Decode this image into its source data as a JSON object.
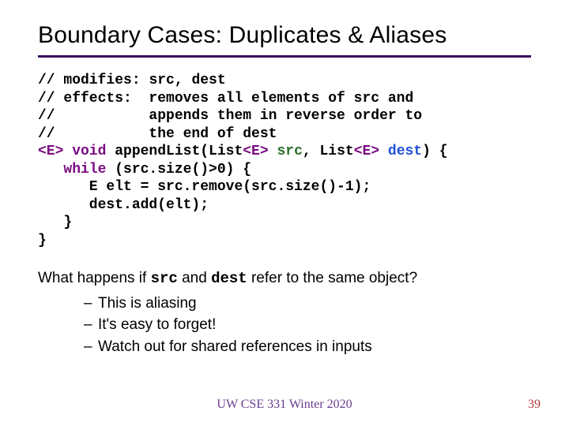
{
  "title": "Boundary Cases: Duplicates & Aliases",
  "code": {
    "c1a": "// modifies: ",
    "c1b": "src",
    "c1c": ", ",
    "c1d": "dest",
    "c2": "// effects:  removes all elements of src and",
    "c3": "//           appends them in reverse order to",
    "c4": "//           the end of dest",
    "l5_kw1": "<E> void",
    "l5_fn": " appendList(List",
    "l5_kw2": "<E>",
    "l5_sp1": " ",
    "l5_src": "src",
    "l5_mid": ", List",
    "l5_kw3": "<E>",
    "l5_sp2": " ",
    "l5_dst": "dest",
    "l5_end": ") {",
    "l6_ind": "   ",
    "l6_kw": "while",
    "l6_rest": " (src.size()>0) {",
    "l7": "      E elt = src.remove(src.size()-1);",
    "l8": "      dest.add(elt);",
    "l9": "   }",
    "l10": "}"
  },
  "question": {
    "q1": "What happens if ",
    "src": "src",
    "q2": " and ",
    "dst": "dest",
    "q3": " refer to the same object?"
  },
  "bullets": {
    "b1a": "This is ",
    "b1b": "aliasing",
    "b2": "It's easy to forget!",
    "b3": "Watch out for shared references in inputs"
  },
  "footer": "UW CSE 331 Winter 2020",
  "pagenum": "39"
}
